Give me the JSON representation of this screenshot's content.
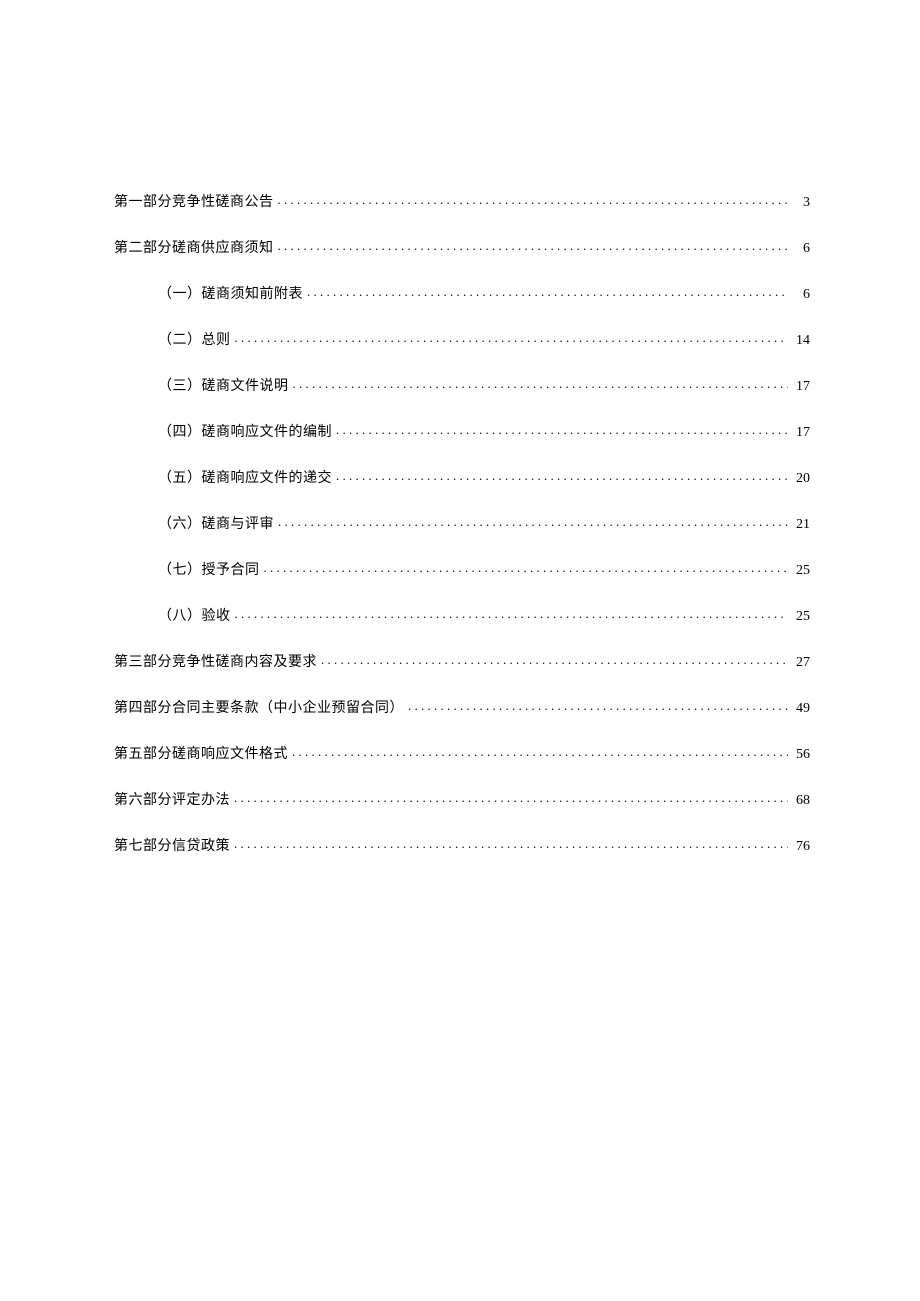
{
  "toc": [
    {
      "level": 1,
      "label": "第一部分竞争性磋商公告",
      "page": "3"
    },
    {
      "level": 1,
      "label": "第二部分磋商供应商须知",
      "page": "6"
    },
    {
      "level": 2,
      "label": "（一）磋商须知前附表",
      "page": "6"
    },
    {
      "level": 2,
      "label": "（二）总则",
      "page": "14"
    },
    {
      "level": 2,
      "label": "（三）磋商文件说明",
      "page": "17"
    },
    {
      "level": 2,
      "label": "（四）磋商响应文件的编制",
      "page": "17"
    },
    {
      "level": 2,
      "label": "（五）磋商响应文件的递交",
      "page": "20"
    },
    {
      "level": 2,
      "label": "（六）磋商与评审",
      "page": "21"
    },
    {
      "level": 2,
      "label": "（七）授予合同",
      "page": "25"
    },
    {
      "level": 2,
      "label": "（八）验收",
      "page": "25"
    },
    {
      "level": 1,
      "label": "第三部分竞争性磋商内容及要求",
      "page": "27"
    },
    {
      "level": 1,
      "label": "第四部分合同主要条款（中小企业预留合同）",
      "page": "49"
    },
    {
      "level": 1,
      "label": "第五部分磋商响应文件格式",
      "page": "56"
    },
    {
      "level": 1,
      "label": "第六部分评定办法",
      "page": "68"
    },
    {
      "level": 1,
      "label": "第七部分信贷政策",
      "page": "76"
    }
  ]
}
